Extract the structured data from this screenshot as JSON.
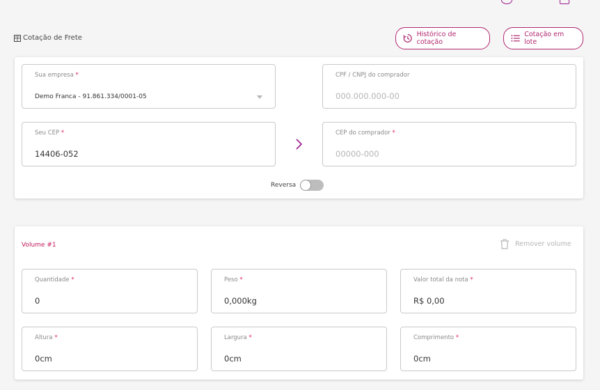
{
  "header": {
    "title": "Cotação de Frete",
    "history_button": "Histórico de cotação",
    "batch_button": "Cotação em lote"
  },
  "route": {
    "company": {
      "label": "Sua empresa",
      "value": "Demo Franca - 91.861.334/0001-05"
    },
    "buyer_doc": {
      "label": "CPF / CNPJ do comprador",
      "placeholder": "000.000.000-00"
    },
    "seller_cep": {
      "label": "Seu CEP",
      "value": "14406-052"
    },
    "buyer_cep": {
      "label": "CEP do comprador",
      "placeholder": "00000-000"
    },
    "reverse": {
      "label": "Reversa",
      "enabled": false
    }
  },
  "volume": {
    "title": "Volume #1",
    "remove_label": "Remover volume",
    "quantity": {
      "label": "Quantidade",
      "value": "0"
    },
    "weight": {
      "label": "Peso",
      "value": "0,000kg"
    },
    "invoice": {
      "label": "Valor total da nota",
      "value": "R$ 0,00"
    },
    "height": {
      "label": "Altura",
      "value": "0cm"
    },
    "width": {
      "label": "Largura",
      "value": "0cm"
    },
    "length": {
      "label": "Comprimento",
      "value": "0cm"
    }
  },
  "required_marker": "*",
  "colors": {
    "accent": "#b0266e",
    "required": "#e0245e",
    "border": "#c9c9c9"
  }
}
